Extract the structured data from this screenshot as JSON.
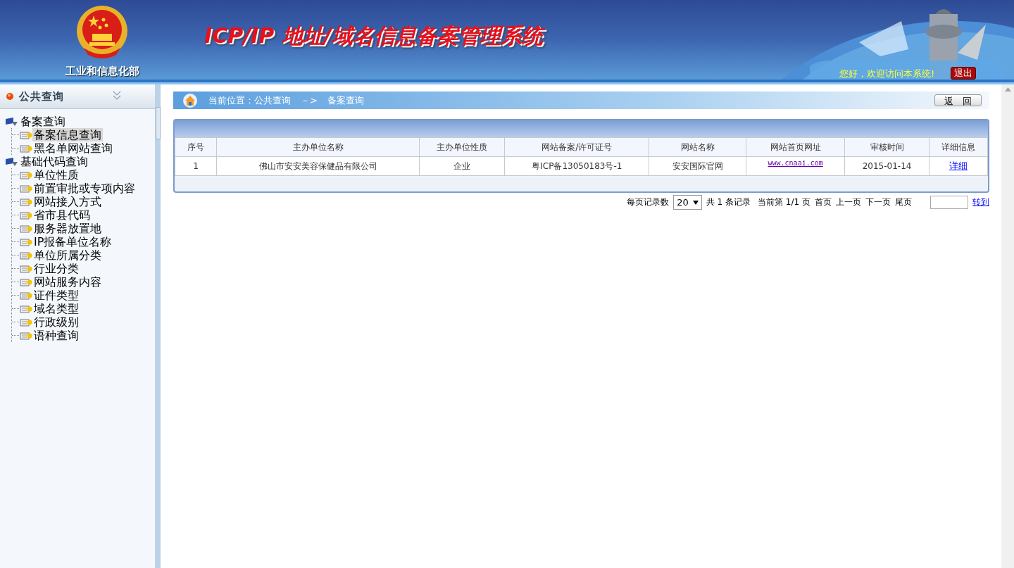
{
  "header": {
    "ministry": "工业和信息化部",
    "title": "ICP/IP 地址/域名信息备案管理系统",
    "greeting": "您好，欢迎访问本系统!",
    "logout": "退出"
  },
  "sidebar": {
    "title": "公共查询",
    "tree": [
      {
        "label": "备案查询",
        "selected": false,
        "children": [
          {
            "label": "备案信息查询",
            "selected": true
          },
          {
            "label": "黑名单网站查询",
            "selected": false
          }
        ]
      },
      {
        "label": "基础代码查询",
        "selected": false,
        "children": [
          {
            "label": "单位性质",
            "selected": false
          },
          {
            "label": "前置审批或专项内容",
            "selected": false
          },
          {
            "label": "网站接入方式",
            "selected": false
          },
          {
            "label": "省市县代码",
            "selected": false
          },
          {
            "label": "服务器放置地",
            "selected": false
          },
          {
            "label": "IP报备单位名称",
            "selected": false
          },
          {
            "label": "单位所属分类",
            "selected": false
          },
          {
            "label": "行业分类",
            "selected": false
          },
          {
            "label": "网站服务内容",
            "selected": false
          },
          {
            "label": "证件类型",
            "selected": false
          },
          {
            "label": "域名类型",
            "selected": false
          },
          {
            "label": "行政级别",
            "selected": false
          },
          {
            "label": "语种查询",
            "selected": false
          }
        ]
      }
    ]
  },
  "breadcrumb": {
    "location": "当前位置：公共查询",
    "arrow": "－>",
    "current": "备案查询"
  },
  "back_button": "返　回",
  "table": {
    "columns": [
      "序号",
      "主办单位名称",
      "主办单位性质",
      "网站备案/许可证号",
      "网站名称",
      "网站首页网址",
      "审核时间",
      "详细信息"
    ],
    "rows": [
      {
        "cells": [
          {
            "kind": "text",
            "text": "1"
          },
          {
            "kind": "text",
            "text": "佛山市安安美容保健品有限公司"
          },
          {
            "kind": "text",
            "text": "企业"
          },
          {
            "kind": "text",
            "text": "粤ICP备13050183号-1"
          },
          {
            "kind": "text",
            "text": "安安国际官网"
          },
          {
            "kind": "visited-link",
            "text": "www.cnaai.com"
          },
          {
            "kind": "text",
            "text": "2015-01-14"
          },
          {
            "kind": "link",
            "text": "详细"
          }
        ]
      }
    ]
  },
  "pagination": {
    "per_page_label": "每页记录数",
    "per_page": "20",
    "total": "共 1 条记录",
    "current": "当前第 1/1 页",
    "pages": [
      "首页",
      "上一页",
      "下一页",
      "尾页"
    ],
    "go": "转到"
  }
}
